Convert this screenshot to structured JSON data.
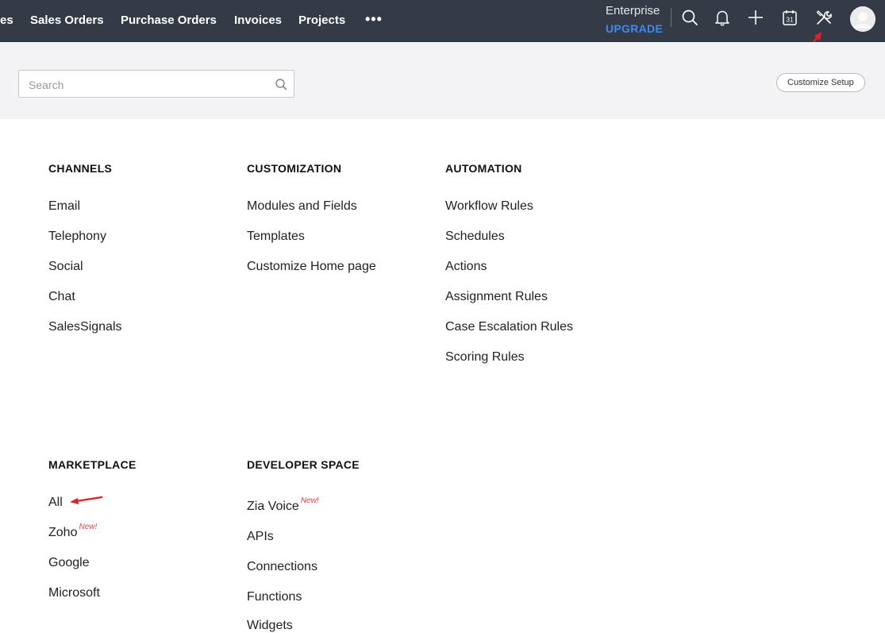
{
  "topnav": {
    "items": [
      "es",
      "Sales Orders",
      "Purchase Orders",
      "Invoices",
      "Projects"
    ],
    "more": "•••",
    "plan": "Enterprise",
    "upgrade": "UPGRADE",
    "icons": [
      "search-icon",
      "bell-icon",
      "plus-icon",
      "calendar-icon",
      "tools-icon",
      "avatar"
    ],
    "calendar_day": "31"
  },
  "search": {
    "placeholder": "Search",
    "value": ""
  },
  "customize_setup": "Customize Setup",
  "sections": {
    "channels": {
      "title": "CHANNELS",
      "items": [
        "Email",
        "Telephony",
        "Social",
        "Chat",
        "SalesSignals"
      ]
    },
    "customization": {
      "title": "CUSTOMIZATION",
      "items": [
        "Modules and Fields",
        "Templates",
        "Customize Home page"
      ]
    },
    "automation": {
      "title": "AUTOMATION",
      "items": [
        "Workflow Rules",
        "Schedules",
        "Actions",
        "Assignment Rules",
        "Case Escalation Rules",
        "Scoring Rules"
      ]
    },
    "marketplace": {
      "title": "MARKETPLACE",
      "items": [
        "All",
        "Zoho",
        "Google",
        "Microsoft"
      ],
      "badges": {
        "Zoho": "New!"
      }
    },
    "developer": {
      "title": "DEVELOPER SPACE",
      "items": [
        "Zia Voice",
        "APIs",
        "Connections",
        "Functions",
        "Widgets"
      ],
      "badges": {
        "Zia Voice": "New!"
      }
    }
  },
  "colors": {
    "topbar": "#353a47",
    "upgrade": "#3d8bf2",
    "new_badge": "#e04848",
    "annotation_arrow": "#d9232a"
  }
}
